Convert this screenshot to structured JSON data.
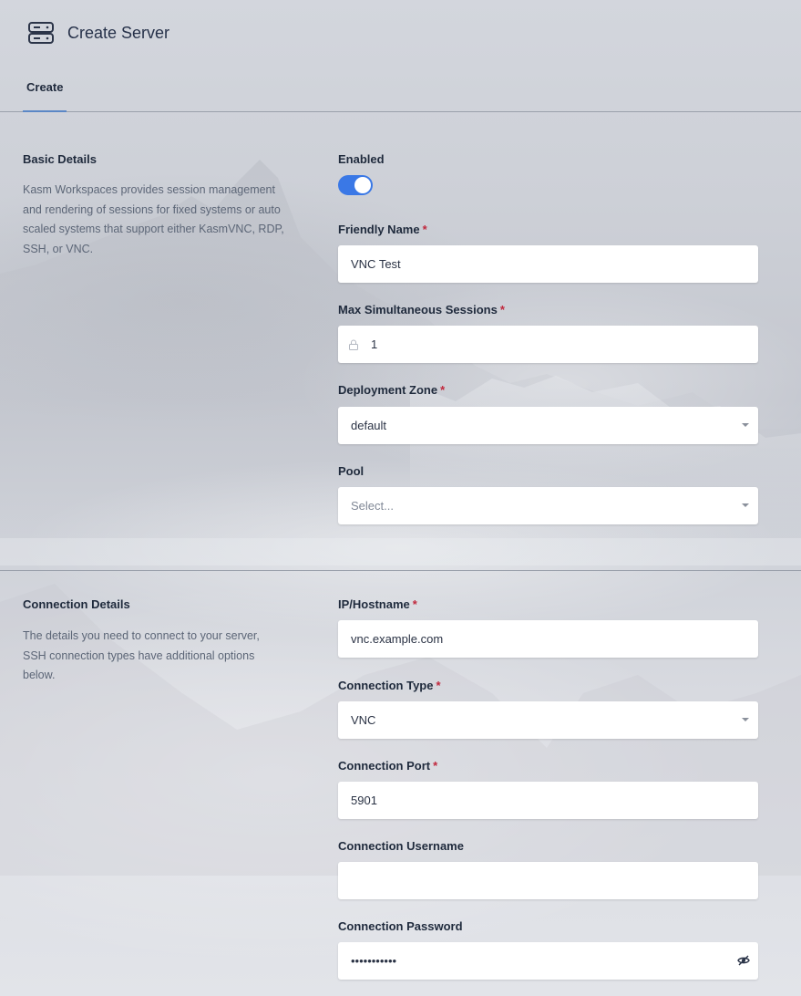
{
  "header": {
    "title": "Create Server",
    "icon": "server-icon"
  },
  "tabs": [
    {
      "label": "Create",
      "active": true
    }
  ],
  "basic": {
    "title": "Basic Details",
    "description": "Kasm Workspaces provides session management and rendering of sessions for fixed systems or auto scaled systems that support either KasmVNC, RDP, SSH, or VNC.",
    "enabled_label": "Enabled",
    "enabled": true,
    "friendly_name_label": "Friendly Name",
    "friendly_name_value": "VNC Test",
    "max_sessions_label": "Max Simultaneous Sessions",
    "max_sessions_value": "1",
    "deployment_zone_label": "Deployment Zone",
    "deployment_zone_value": "default",
    "pool_label": "Pool",
    "pool_placeholder": "Select..."
  },
  "connection": {
    "title": "Connection Details",
    "description": "The details you need to connect to your server, SSH connection types have additional options below.",
    "ip_label": "IP/Hostname",
    "ip_value": "vnc.example.com",
    "type_label": "Connection Type",
    "type_value": "VNC",
    "port_label": "Connection Port",
    "port_value": "5901",
    "username_label": "Connection Username",
    "username_value": "",
    "password_label": "Connection Password",
    "password_value": "•••••••••••"
  },
  "required_marker": "*",
  "colors": {
    "accent": "#3a78e6",
    "required": "#c0283d",
    "tab_underline": "#5b87c6"
  }
}
